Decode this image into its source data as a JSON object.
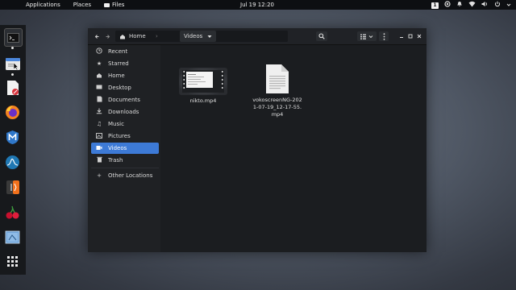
{
  "topbar": {
    "applications": "Applications",
    "places": "Places",
    "files": "Files",
    "clock": "Jul 19  12:20",
    "workspace": "1"
  },
  "dock": {
    "icons": [
      "terminal-icon",
      "file-manager-icon",
      "text-editor-icon",
      "firefox-icon",
      "metasploit-icon",
      "wireshark-icon",
      "burpsuite-icon",
      "cherrytree-icon",
      "screenshot-icon",
      "app-grid-icon"
    ]
  },
  "window": {
    "breadcrumb_home": "Home",
    "breadcrumb_current": "Videos",
    "sidebar": [
      {
        "label": "Recent",
        "icon": "clock-icon"
      },
      {
        "label": "Starred",
        "icon": "star-icon"
      },
      {
        "label": "Home",
        "icon": "home-icon"
      },
      {
        "label": "Desktop",
        "icon": "desktop-icon"
      },
      {
        "label": "Documents",
        "icon": "documents-icon"
      },
      {
        "label": "Downloads",
        "icon": "downloads-icon"
      },
      {
        "label": "Music",
        "icon": "music-icon"
      },
      {
        "label": "Pictures",
        "icon": "pictures-icon"
      },
      {
        "label": "Videos",
        "icon": "videos-icon",
        "active": true
      },
      {
        "label": "Trash",
        "icon": "trash-icon"
      },
      {
        "label": "Other Locations",
        "icon": "plus-icon"
      }
    ],
    "files": [
      {
        "name": "nikto.mp4",
        "type": "video"
      },
      {
        "name": "vokoscreenNG-2021-07-19_12-17-55.mp4",
        "type": "document"
      }
    ]
  },
  "colors": {
    "accent": "#3d7ad6",
    "topbar_bg": "#0d0f12",
    "dock_bg": "#17191c",
    "window_bg": "#1b1d20"
  }
}
